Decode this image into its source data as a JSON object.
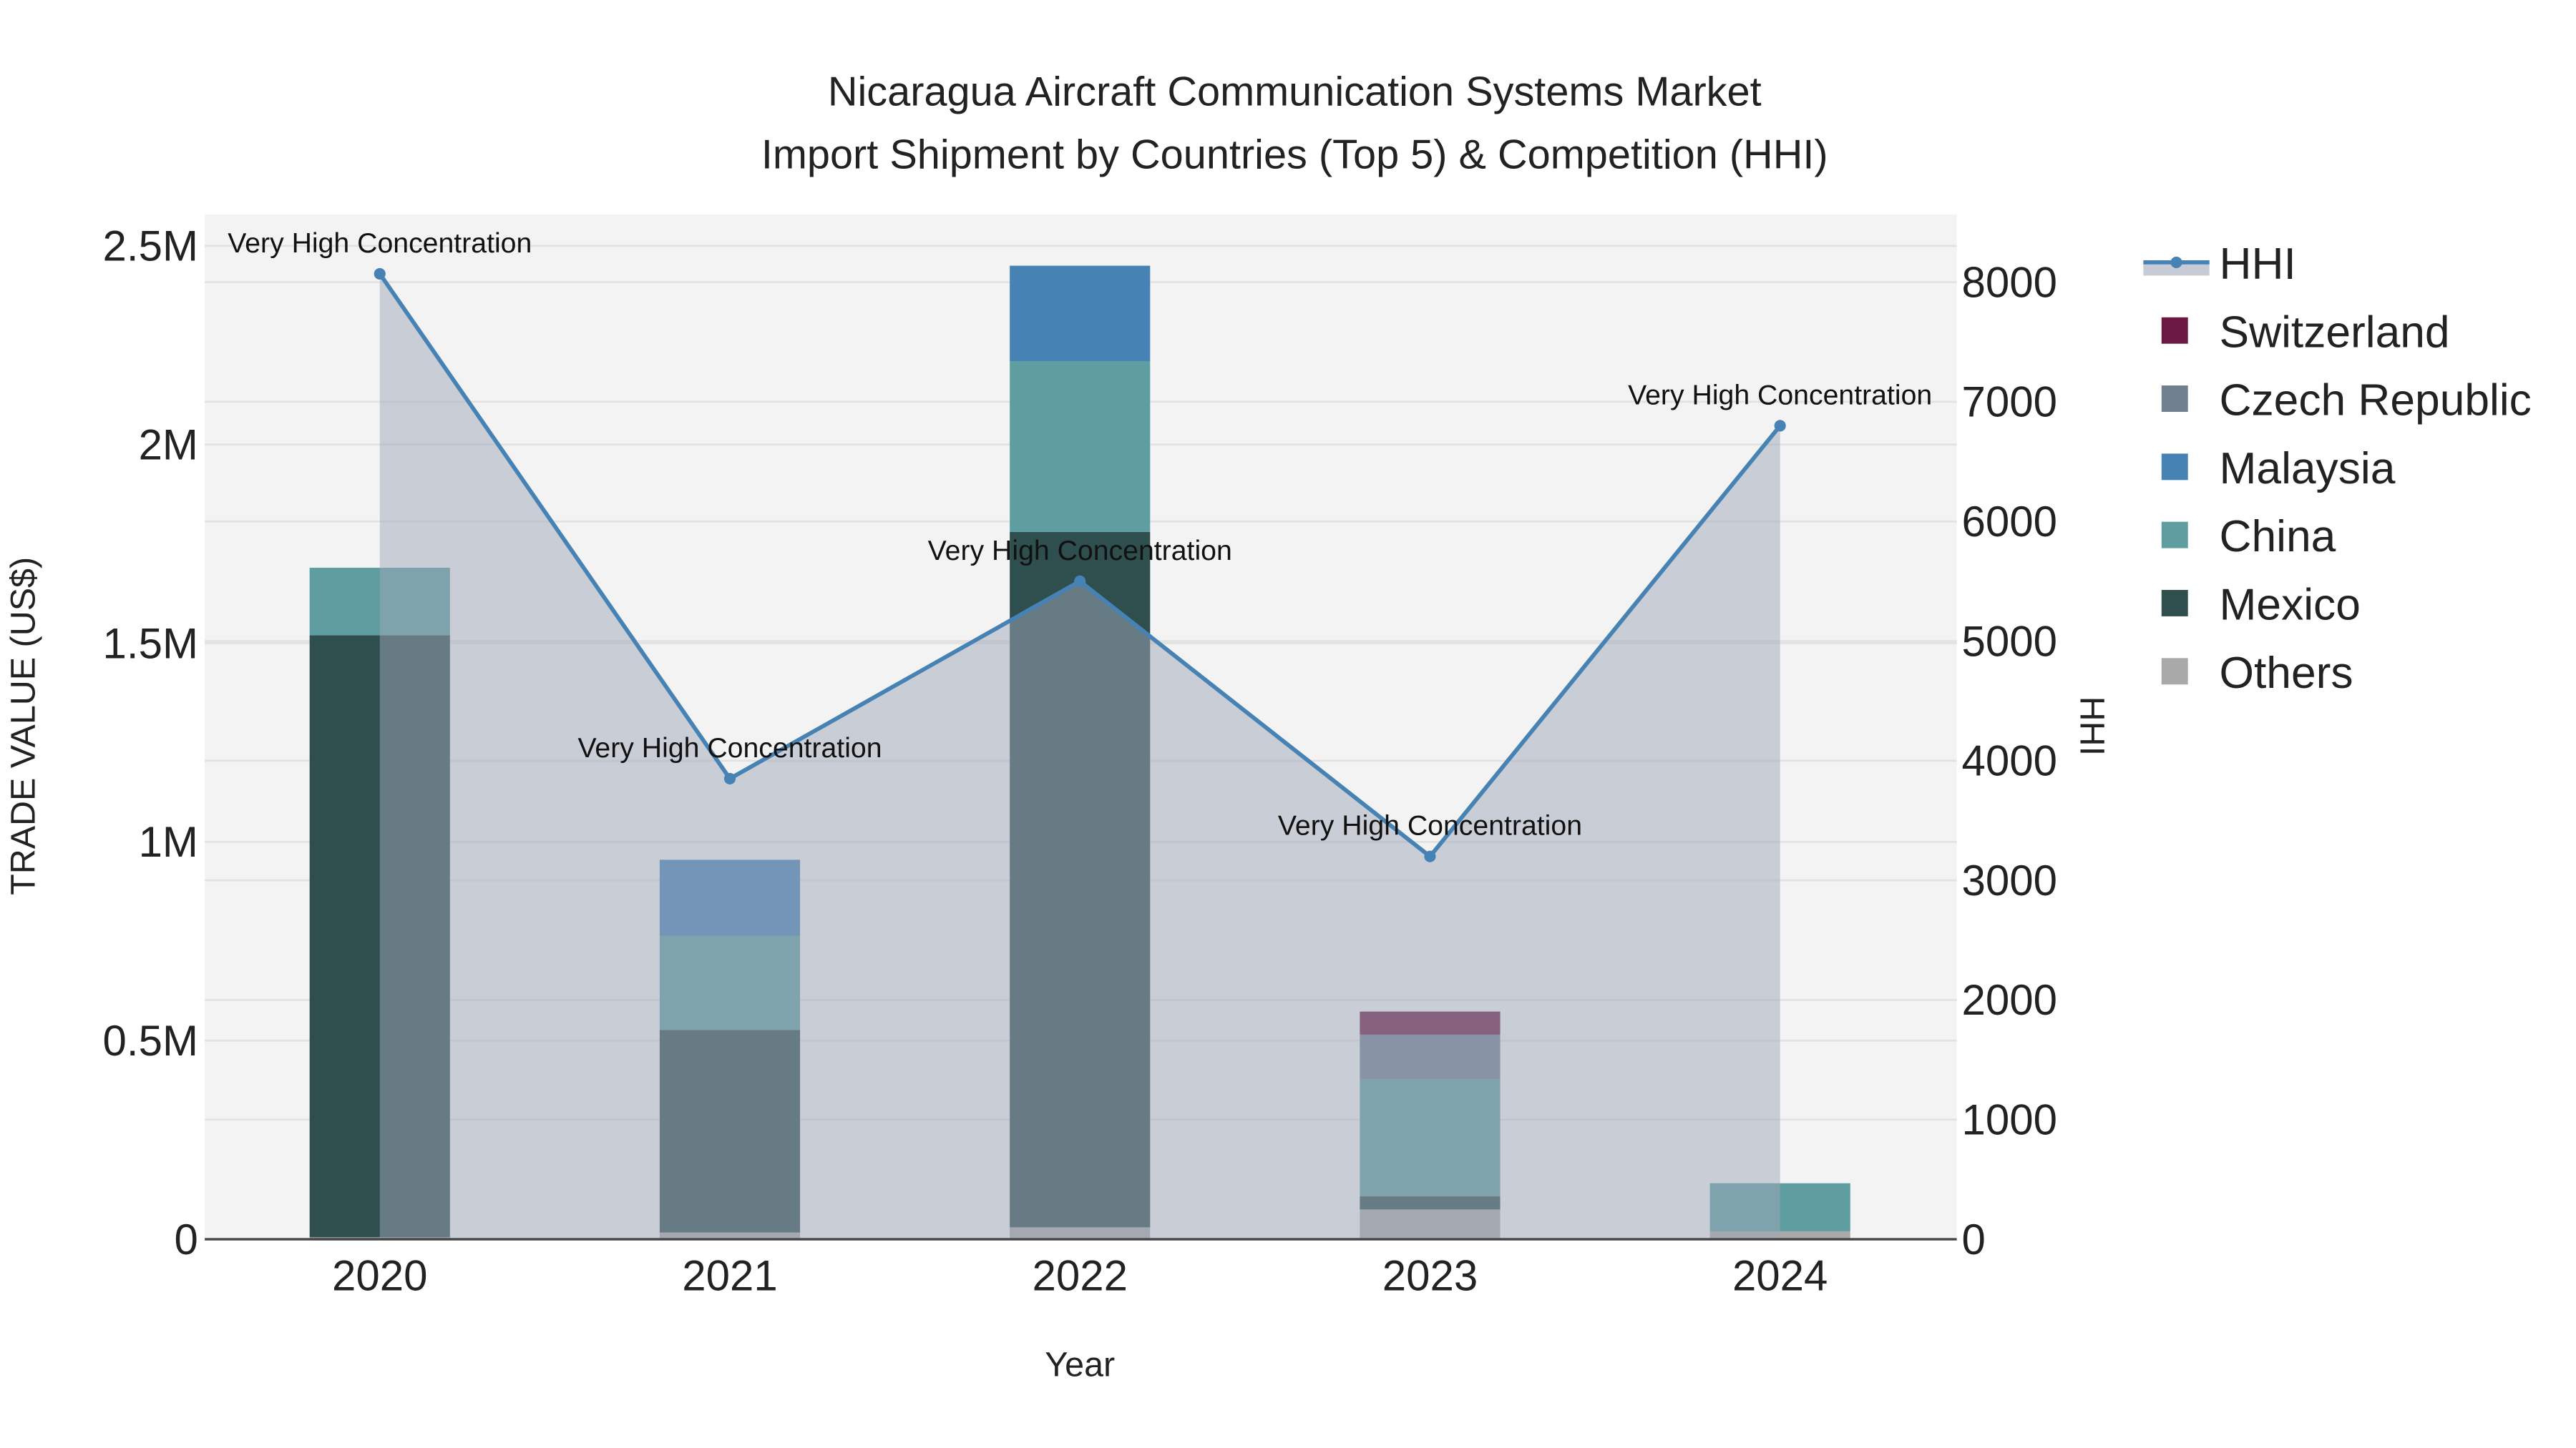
{
  "chart_data": {
    "type": "bar",
    "stacked": true,
    "title": "Nicaragua Aircraft Communication Systems Market",
    "subtitle": "Import Shipment by Countries (Top 5) & Competition (HHI)",
    "xlabel": "Year",
    "ylabel": "TRADE VALUE (US$)",
    "y2label": "HHI",
    "categories": [
      "2020",
      "2021",
      "2022",
      "2023",
      "2024"
    ],
    "ylim": [
      0,
      2500000
    ],
    "y2lim": [
      0,
      8000
    ],
    "yticks": [
      {
        "v": 0,
        "label": "0"
      },
      {
        "v": 500000,
        "label": "0.5M"
      },
      {
        "v": 1000000,
        "label": "1M"
      },
      {
        "v": 1500000,
        "label": "1.5M"
      },
      {
        "v": 2000000,
        "label": "2M"
      },
      {
        "v": 2500000,
        "label": "2.5M"
      }
    ],
    "y2ticks": [
      0,
      1000,
      2000,
      3000,
      4000,
      5000,
      6000,
      7000,
      8000
    ],
    "grid": true,
    "legend_position": "right",
    "series": [
      {
        "name": "Others",
        "color": "#a9a9a9",
        "values": [
          5000,
          17000,
          30000,
          75000,
          20000
        ]
      },
      {
        "name": "Mexico",
        "color": "#2f4f4f",
        "values": [
          1515000,
          510000,
          1750000,
          33000,
          0
        ]
      },
      {
        "name": "China",
        "color": "#5f9ea0",
        "values": [
          170000,
          237000,
          430000,
          295000,
          121000
        ]
      },
      {
        "name": "Malaysia",
        "color": "#4682b4",
        "values": [
          0,
          191000,
          240000,
          0,
          0
        ]
      },
      {
        "name": "Czech Republic",
        "color": "#708090",
        "values": [
          0,
          0,
          0,
          112000,
          0
        ]
      },
      {
        "name": "Switzerland",
        "color": "#6a1a42",
        "values": [
          0,
          0,
          0,
          58000,
          0
        ]
      }
    ],
    "hhi": {
      "name": "HHI",
      "color": "#4682b4",
      "values": [
        8070,
        3850,
        5500,
        3200,
        6800
      ],
      "annotations": [
        "Very High Concentration",
        "Very High Concentration",
        "Very High Concentration",
        "Very High Concentration",
        "Very High Concentration"
      ]
    },
    "legend_order": [
      "HHI",
      "Switzerland",
      "Czech Republic",
      "Malaysia",
      "China",
      "Mexico",
      "Others"
    ]
  }
}
